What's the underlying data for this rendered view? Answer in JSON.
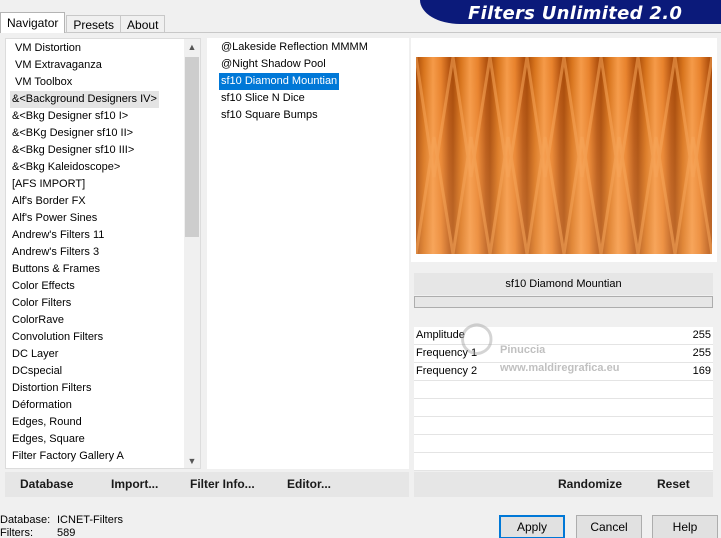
{
  "tabs": [
    {
      "label": "Navigator"
    },
    {
      "label": "Presets"
    },
    {
      "label": "About"
    }
  ],
  "banner": {
    "title": "Filters Unlimited 2.0",
    "color": "#0b1a7a"
  },
  "categories": [
    {
      "label": "VM Distortion"
    },
    {
      "label": "VM Extravaganza"
    },
    {
      "label": "VM Toolbox"
    },
    {
      "label": "&<Background Designers IV>"
    },
    {
      "label": "&<Bkg Designer sf10 I>"
    },
    {
      "label": "&<BKg Designer sf10 II>"
    },
    {
      "label": "&<Bkg Designer sf10 III>"
    },
    {
      "label": "&<Bkg Kaleidoscope>"
    },
    {
      "label": "[AFS IMPORT]"
    },
    {
      "label": "Alf's Border FX"
    },
    {
      "label": "Alf's Power Sines"
    },
    {
      "label": "Andrew's Filters 11"
    },
    {
      "label": "Andrew's Filters 3"
    },
    {
      "label": "Buttons & Frames"
    },
    {
      "label": "Color Effects"
    },
    {
      "label": "Color Filters"
    },
    {
      "label": "ColorRave"
    },
    {
      "label": "Convolution Filters"
    },
    {
      "label": "DC Layer"
    },
    {
      "label": "DCspecial"
    },
    {
      "label": "Distortion Filters"
    },
    {
      "label": "Déformation"
    },
    {
      "label": "Edges, Round"
    },
    {
      "label": "Edges, Square"
    },
    {
      "label": "Filter Factory Gallery A"
    }
  ],
  "filters": [
    {
      "label": "@Lakeside Reflection MMMM"
    },
    {
      "label": "@Night Shadow Pool"
    },
    {
      "label": "sf10 Diamond Mountian"
    },
    {
      "label": "sf10 Slice N Dice"
    },
    {
      "label": "sf10 Square Bumps"
    }
  ],
  "preview": {
    "title": "sf10 Diamond Mountian"
  },
  "params": [
    {
      "name": "Amplitude",
      "value": "255"
    },
    {
      "name": "Frequency 1",
      "value": "255"
    },
    {
      "name": "Frequency 2",
      "value": "169"
    }
  ],
  "watermark": {
    "line1": "Pinuccia",
    "line2": "www.maldiregrafica.eu"
  },
  "toolbar": {
    "database": "Database",
    "import": "Import...",
    "filter_info": "Filter Info...",
    "editor": "Editor...",
    "randomize": "Randomize",
    "reset": "Reset"
  },
  "status": {
    "database_label": "Database:",
    "database_value": "ICNET-Filters",
    "filters_label": "Filters:",
    "filters_value": "589"
  },
  "dialog": {
    "apply": "Apply",
    "cancel": "Cancel",
    "help": "Help"
  },
  "colors": {
    "selection": "#0078d7",
    "preview_orange": "#e8822c"
  }
}
